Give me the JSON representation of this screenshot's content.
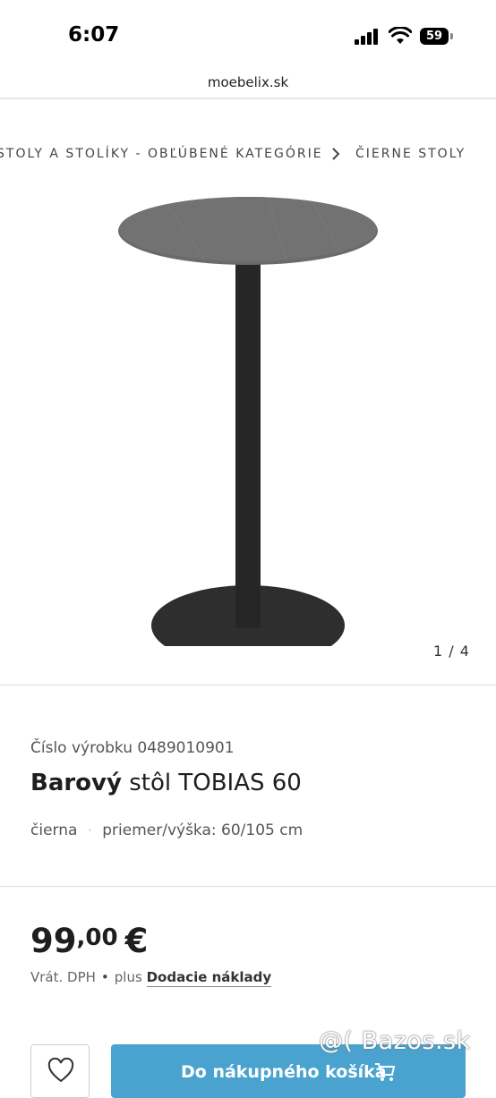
{
  "status_bar": {
    "time": "6:07",
    "battery": "59"
  },
  "browser": {
    "url": "moebelix.sk"
  },
  "breadcrumb": {
    "items": [
      "STOLY A STOLÍKY - OBĽÚBENÉ KATEGÓRIE",
      "ČIERNE STOLY"
    ]
  },
  "gallery": {
    "counter": "1 / 4"
  },
  "product": {
    "number_label": "Číslo výrobku 0489010901",
    "title_bold": "Barový",
    "title_rest": "stôl TOBIAS 60",
    "color": "čierna",
    "attribute_separator": "·",
    "dimensions": "priemer/výška: 60/105 cm"
  },
  "price": {
    "integer": "99",
    "decimal": ",00",
    "currency": "€"
  },
  "tax": {
    "vat_label": "Vrát. DPH",
    "separator": "•",
    "plus": "plus",
    "shipping_link": "Dodacie náklady"
  },
  "actions": {
    "add_to_cart_label": "Do nákupného košíka"
  },
  "watermark": {
    "text": "@( Bazos.sk"
  },
  "colors": {
    "cart_button": "#4aa3cf",
    "table": "#2e2e2e",
    "table_top": "#6a6a6a"
  },
  "icons": {
    "signal": "signal-icon",
    "wifi": "wifi-icon",
    "wishlist": "heart-icon",
    "cart": "cart-icon",
    "breadcrumb_sep": "chevron-right-icon"
  }
}
